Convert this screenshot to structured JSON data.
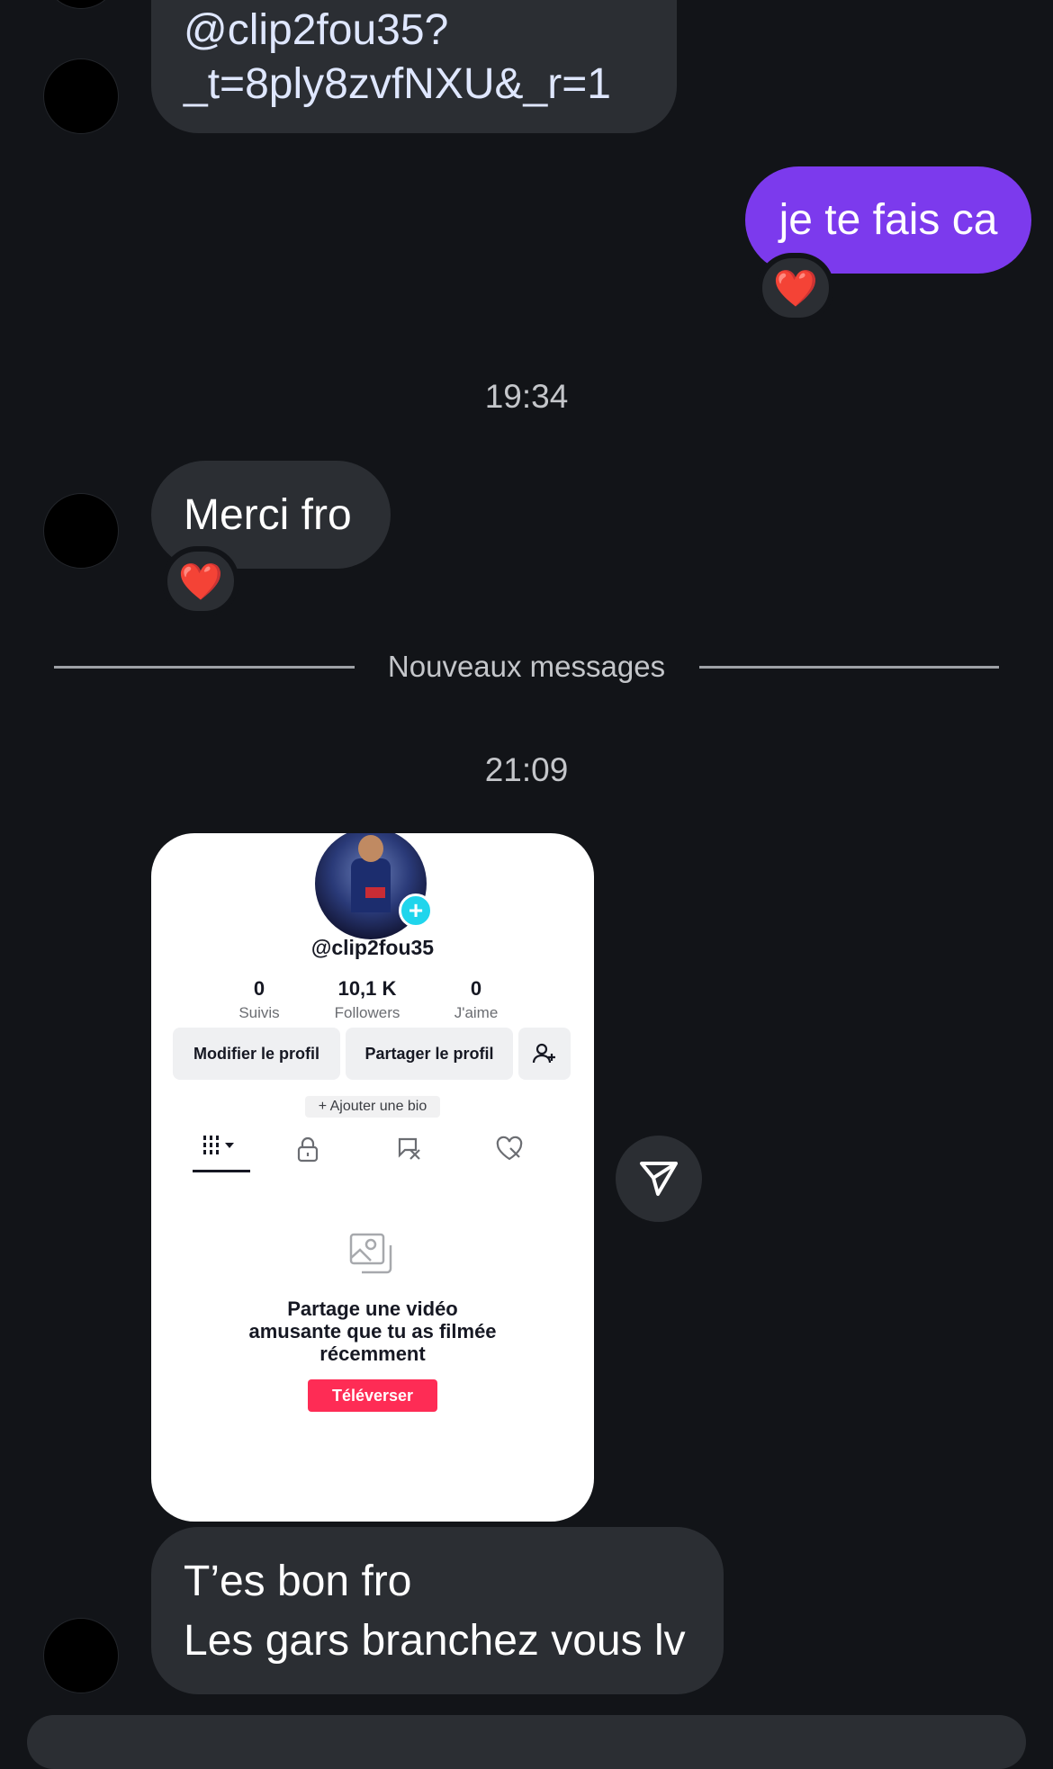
{
  "messages": {
    "link_line1": "@clip2fou35?",
    "link_line2": "_t=8ply8zvfNXU&_r=1",
    "sent_text": "je te fais ca",
    "time1": "19:34",
    "received_text": "Merci fro",
    "new_messages_label": "Nouveaux messages",
    "time2": "21:09",
    "last_line1": "T’es bon fro",
    "last_line2": "Les gars branchez vous lv"
  },
  "reactions": {
    "emoji": "❤️"
  },
  "profile_card": {
    "handle": "@clip2fou35",
    "stats": [
      {
        "value": "0",
        "label": "Suivis"
      },
      {
        "value": "10,1 K",
        "label": "Followers"
      },
      {
        "value": "0",
        "label": "J'aime"
      }
    ],
    "edit_button": "Modifier le profil",
    "share_button": "Partager le profil",
    "add_bio": "+ Ajouter une bio",
    "empty_line1": "Partage une vidéo",
    "empty_line2": "amusante que tu as filmée",
    "empty_line3": "récemment",
    "upload_button": "Téléverser",
    "upload_color": "#fe2c55",
    "plus_badge_color": "#20d5ec"
  },
  "icons": {
    "share": "send-icon",
    "tabs": [
      "grid-icon",
      "lock-icon",
      "repost-icon",
      "liked-icon"
    ]
  }
}
